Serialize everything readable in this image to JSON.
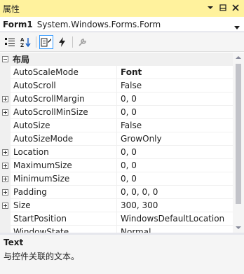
{
  "window": {
    "title": "属性",
    "controls": [
      "dropdown-icon",
      "pin-icon",
      "close-icon"
    ]
  },
  "selector": {
    "object_name": "Form1",
    "object_type": "System.Windows.Forms.Form"
  },
  "toolbar": {
    "buttons": [
      "categorized-icon",
      "alphabetical-icon",
      "properties-icon",
      "events-icon",
      "property-pages-icon"
    ],
    "active": "properties-icon"
  },
  "grid": {
    "category": "布局",
    "rows": [
      {
        "name": "AutoScaleMode",
        "value": "Font",
        "expandable": false,
        "bold": true
      },
      {
        "name": "AutoScroll",
        "value": "False",
        "expandable": false,
        "bold": false
      },
      {
        "name": "AutoScrollMargin",
        "value": "0, 0",
        "expandable": true,
        "bold": false
      },
      {
        "name": "AutoScrollMinSize",
        "value": "0, 0",
        "expandable": true,
        "bold": false
      },
      {
        "name": "AutoSize",
        "value": "False",
        "expandable": false,
        "bold": false
      },
      {
        "name": "AutoSizeMode",
        "value": "GrowOnly",
        "expandable": false,
        "bold": false
      },
      {
        "name": "Location",
        "value": "0, 0",
        "expandable": true,
        "bold": false
      },
      {
        "name": "MaximumSize",
        "value": "0, 0",
        "expandable": true,
        "bold": false
      },
      {
        "name": "MinimumSize",
        "value": "0, 0",
        "expandable": true,
        "bold": false
      },
      {
        "name": "Padding",
        "value": "0, 0, 0, 0",
        "expandable": true,
        "bold": false
      },
      {
        "name": "Size",
        "value": "300, 300",
        "expandable": true,
        "bold": false
      },
      {
        "name": "StartPosition",
        "value": "WindowsDefaultLocation",
        "expandable": false,
        "bold": false
      },
      {
        "name": "WindowState",
        "value": "Normal",
        "expandable": false,
        "bold": false
      }
    ]
  },
  "description": {
    "title": "Text",
    "text": "与控件关联的文本。"
  },
  "colors": {
    "title_bar": "#fff29d",
    "selection_border": "#3399ff",
    "gutter": "#f0f0f0"
  }
}
